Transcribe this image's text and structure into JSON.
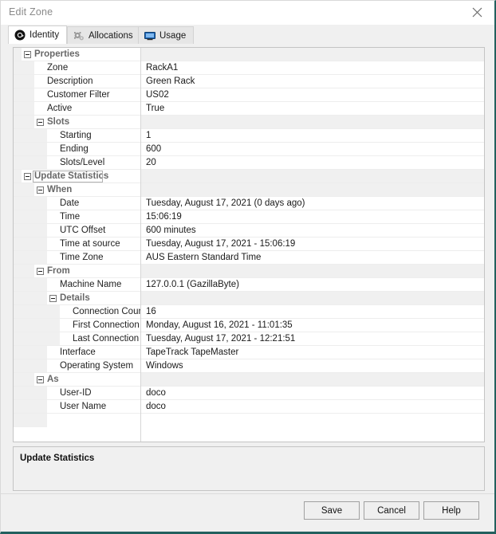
{
  "window": {
    "title": "Edit Zone",
    "close_icon": "close-icon",
    "border_color": "#23605e"
  },
  "tabs": [
    {
      "label": "Identity",
      "icon": "at-sign-icon",
      "active": true
    },
    {
      "label": "Allocations",
      "icon": "gears-icon",
      "active": false
    },
    {
      "label": "Usage",
      "icon": "monitor-icon",
      "active": false
    }
  ],
  "grid": {
    "selected_row": "Update Statistics",
    "rows": [
      {
        "name": "Properties",
        "value": "",
        "type": "category",
        "level": 0
      },
      {
        "name": "Zone",
        "value": "RackA1",
        "type": "property",
        "level": 1
      },
      {
        "name": "Description",
        "value": "Green Rack",
        "type": "property",
        "level": 1
      },
      {
        "name": "Customer Filter",
        "value": "US02",
        "type": "property",
        "level": 1
      },
      {
        "name": "Active",
        "value": "True",
        "type": "property",
        "level": 1
      },
      {
        "name": "Slots",
        "value": "",
        "type": "category",
        "level": 1
      },
      {
        "name": "Starting",
        "value": "1",
        "type": "property",
        "level": 2
      },
      {
        "name": "Ending",
        "value": "600",
        "type": "property",
        "level": 2
      },
      {
        "name": "Slots/Level",
        "value": "20",
        "type": "property",
        "level": 2
      },
      {
        "name": "Update Statistics",
        "value": "",
        "type": "category",
        "level": 0
      },
      {
        "name": "When",
        "value": "",
        "type": "category",
        "level": 1
      },
      {
        "name": "Date",
        "value": "Tuesday, August 17, 2021 (0 days ago)",
        "type": "property",
        "level": 2
      },
      {
        "name": "Time",
        "value": "15:06:19",
        "type": "property",
        "level": 2
      },
      {
        "name": "UTC Offset",
        "value": "600 minutes",
        "type": "property",
        "level": 2
      },
      {
        "name": "Time at source",
        "value": "Tuesday, August 17, 2021 - 15:06:19",
        "type": "property",
        "level": 2
      },
      {
        "name": "Time Zone",
        "value": "AUS Eastern Standard Time",
        "type": "property",
        "level": 2
      },
      {
        "name": "From",
        "value": "",
        "type": "category",
        "level": 1
      },
      {
        "name": "Machine Name",
        "value": "127.0.0.1 (GazillaByte)",
        "type": "property",
        "level": 2
      },
      {
        "name": "Details",
        "value": "",
        "type": "category",
        "level": 2
      },
      {
        "name": "Connection Count",
        "value": "16",
        "type": "property",
        "level": 3
      },
      {
        "name": "First Connection",
        "value": "Monday, August 16, 2021 - 11:01:35",
        "type": "property",
        "level": 3
      },
      {
        "name": "Last Connection",
        "value": "Tuesday, August 17, 2021 - 12:21:51",
        "type": "property",
        "level": 3
      },
      {
        "name": "Interface",
        "value": "TapeTrack TapeMaster",
        "type": "property",
        "level": 2
      },
      {
        "name": "Operating System",
        "value": "Windows",
        "type": "property",
        "level": 2
      },
      {
        "name": "As",
        "value": "",
        "type": "category",
        "level": 1
      },
      {
        "name": "User-ID",
        "value": "doco",
        "type": "property",
        "level": 2
      },
      {
        "name": "User Name",
        "value": "doco",
        "type": "property",
        "level": 2
      },
      {
        "name": "",
        "value": "",
        "type": "blank",
        "level": 2
      }
    ]
  },
  "description": {
    "title": "Update Statistics",
    "body": ""
  },
  "buttons": [
    {
      "label": "Save"
    },
    {
      "label": "Cancel"
    },
    {
      "label": "Help"
    }
  ]
}
